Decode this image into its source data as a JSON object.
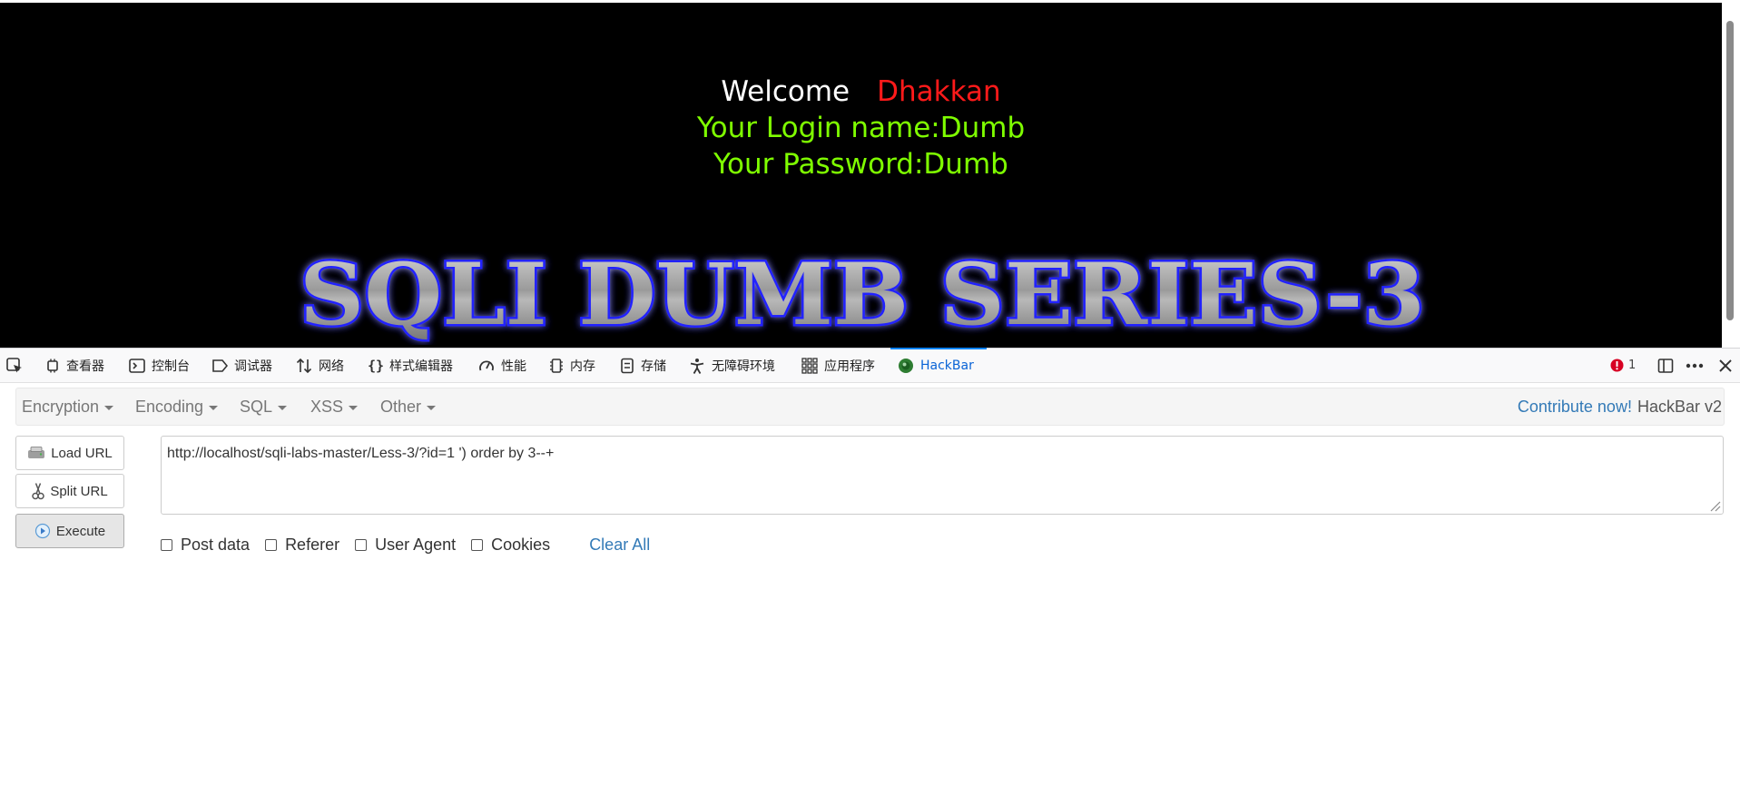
{
  "page": {
    "welcome_text": "Welcome",
    "welcome_name": "Dhakkan",
    "login_line": "Your Login name:Dumb",
    "password_line": "Your Password:Dumb",
    "banner_text": "SQLI DUMB SERIES-3",
    "colors": {
      "background": "#000000",
      "welcome": "#ffffff",
      "name": "#ff1a1a",
      "credentials": "#7fff00",
      "banner_glow": "#1a1aff"
    }
  },
  "devtools": {
    "tabs": [
      {
        "label": "查看器",
        "icon": "inspector-icon"
      },
      {
        "label": "控制台",
        "icon": "console-icon"
      },
      {
        "label": "调试器",
        "icon": "debugger-icon"
      },
      {
        "label": "网络",
        "icon": "network-icon"
      },
      {
        "label": "样式编辑器",
        "icon": "style-editor-icon"
      },
      {
        "label": "性能",
        "icon": "performance-icon"
      },
      {
        "label": "内存",
        "icon": "memory-icon"
      },
      {
        "label": "存储",
        "icon": "storage-icon"
      },
      {
        "label": "无障碍环境",
        "icon": "accessibility-icon"
      },
      {
        "label": "应用程序",
        "icon": "application-icon"
      },
      {
        "label": "HackBar",
        "icon": "hackbar-icon",
        "active": true
      }
    ],
    "error_count": "1",
    "active_color": "#0a84ff"
  },
  "hackbar": {
    "menus": [
      "Encryption",
      "Encoding",
      "SQL",
      "XSS",
      "Other"
    ],
    "contribute_label": "Contribute now!",
    "version_label": "HackBar v2",
    "buttons": {
      "load_url": "Load URL",
      "split_url": "Split URL",
      "execute": "Execute"
    },
    "url_value": "http://localhost/sqli-labs-master/Less-3/?id=1 ') order by 3--+",
    "options": [
      {
        "label": "Post data",
        "checked": false
      },
      {
        "label": "Referer",
        "checked": false
      },
      {
        "label": "User Agent",
        "checked": false
      },
      {
        "label": "Cookies",
        "checked": false
      }
    ],
    "clear_all_label": "Clear All"
  }
}
